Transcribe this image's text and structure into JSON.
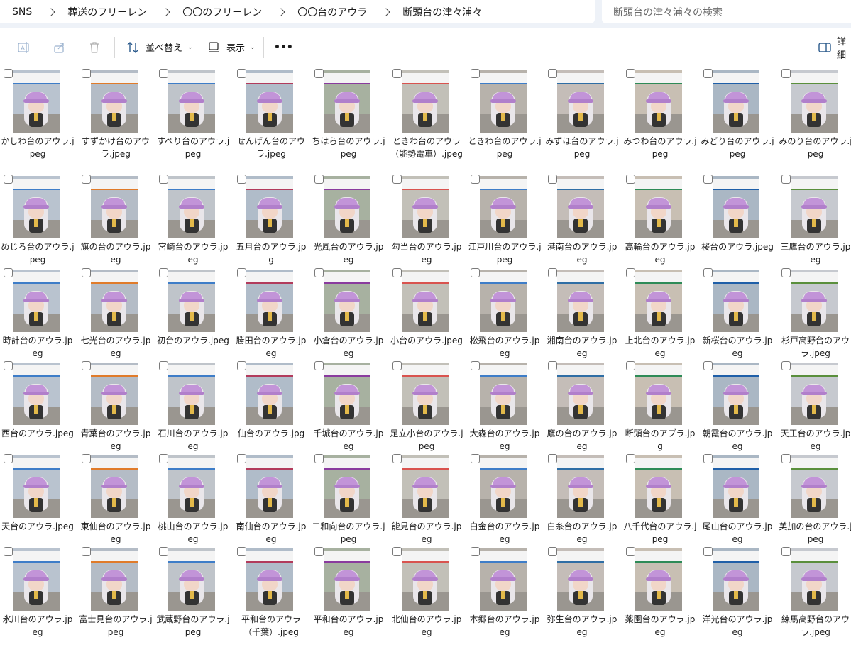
{
  "breadcrumb": [
    "SNS",
    "葬送のフリーレン",
    "〇〇のフリーレン",
    "〇〇台のアウラ",
    "断頭台の津々浦々"
  ],
  "search": {
    "placeholder": "断頭台の津々浦々の検索"
  },
  "toolbar": {
    "sort_label": "並べ替え",
    "view_label": "表示",
    "more_label": "•••",
    "details_label": "詳細"
  },
  "colors": {
    "accent": "#3e7dc8",
    "cap": "#c294d8",
    "background": "#ffffff",
    "topbar": "#eef2f8"
  },
  "files": [
    "かしわ台のアウラ.jpeg",
    "すずかけ台のアウラ.jpeg",
    "すべり台のアウラ.jpeg",
    "せんげん台のアウラ.jpeg",
    "ちはら台のアウラ.jpeg",
    "ときわ台のアウラ（能勢電車）.jpeg",
    "ときわ台のアウラ.jpeg",
    "みずほ台のアウラ.jpeg",
    "みつわ台のアウラ.jpeg",
    "みどり台のアウラ.jpeg",
    "みのり台のアウラ.jpeg",
    "めじろ台のアウラ.jpeg",
    "旗の台のアウラ.jpeg",
    "宮崎台のアウラ.jpeg",
    "五月台のアウラ.jpg",
    "光風台のアウラ.jpeg",
    "勾当台のアウラ.jpeg",
    "江戸川台のアウラ.jpeg",
    "港南台のアウラ.jpeg",
    "高輪台のアウラ.jpeg",
    "桜台のアウラ.jpeg",
    "三鷹台のアウラ.jpeg",
    "時計台のアウラ.jpeg",
    "七光台のアウラ.jpeg",
    "初台のアウラ.jpeg",
    "勝田台のアウラ.jpeg",
    "小倉台のアウラ.jpeg",
    "小台のアウラ.jpeg",
    "松飛台のアウラ.jpeg",
    "湘南台のアウラ.jpeg",
    "上北台のアウラ.jpeg",
    "新桜台のアウラ.jpeg",
    "杉戸高野台のアウラ.jpeg",
    "西台のアウラ.jpeg",
    "青葉台のアウラ.jpeg",
    "石川台のアウラ.jpeg",
    "仙台のアウラ.jpg",
    "千城台のアウラ.jpeg",
    "足立小台のアウラ.jpeg",
    "大森台のアウラ.jpeg",
    "鷹の台のアウラ.jpeg",
    "断頭台のアブラ.jpg",
    "朝霞台のアウラ.jpeg",
    "天王台のアウラ.jpeg",
    "天台のアウラ.jpeg",
    "東仙台のアウラ.jpeg",
    "桃山台のアウラ.jpeg",
    "南仙台のアウラ.jpeg",
    "二和向台のアウラ.jpeg",
    "能見台のアウラ.jpeg",
    "白金台のアウラ.jpeg",
    "白糸台のアウラ.jpeg",
    "八千代台のアウラ.jpeg",
    "尾山台のアウラ.jpeg",
    "美加の台のアウラ.jpeg",
    "氷川台のアウラ.jpeg",
    "富士見台のアウラ.jpeg",
    "武蔵野台のアウラ.jpeg",
    "平和台のアウラ（千葉）.jpeg",
    "平和台のアウラ.jpeg",
    "北仙台のアウラ.jpeg",
    "本郷台のアウラ.jpeg",
    "弥生台のアウラ.jpeg",
    "薬園台のアウラ.jpeg",
    "洋光台のアウラ.jpeg",
    "練馬高野台のアウラ.jpeg"
  ]
}
